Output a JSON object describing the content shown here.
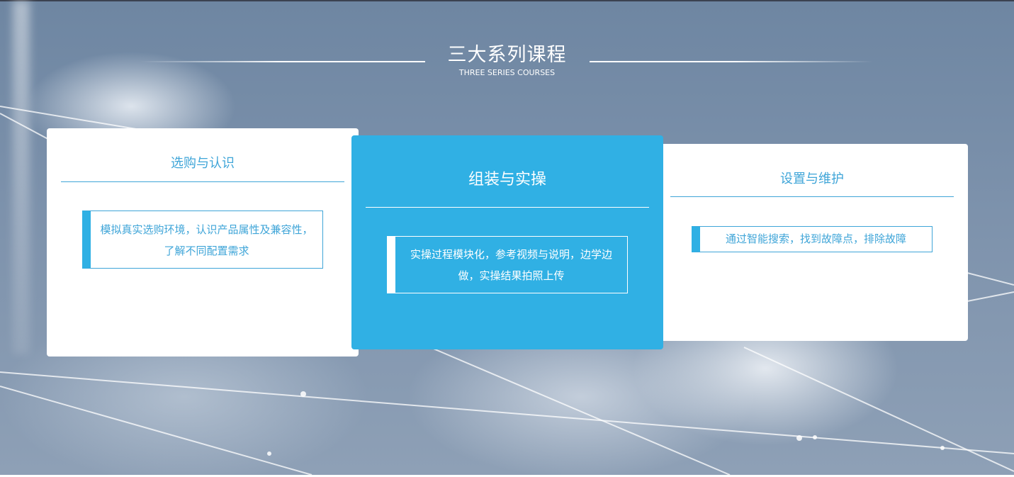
{
  "section": {
    "title": "三大系列课程",
    "subtitle": "THREE SERIES COURSES"
  },
  "courses": [
    {
      "title": "选购与认识",
      "description": "模拟真实选购环境，认识产品属性及兼容性，了解不同配置需求",
      "active": false
    },
    {
      "title": "组装与实操",
      "description": "实操过程模块化，参考视频与说明，边学边做，实操结果拍照上传",
      "active": true
    },
    {
      "title": "设置与维护",
      "description": "通过智能搜索，找到故障点，排除故障",
      "active": false
    }
  ],
  "colors": {
    "accent": "#30b0e4",
    "accent_text": "#3fa5d8",
    "card_background": "#ffffff",
    "heading_text": "#ffffff"
  }
}
